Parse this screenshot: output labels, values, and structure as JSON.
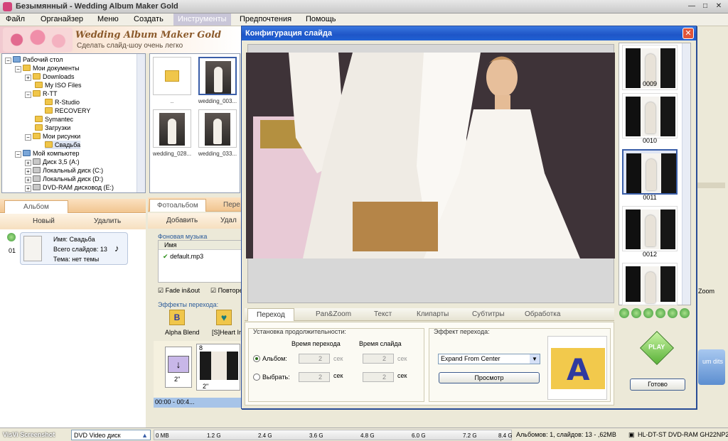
{
  "app": {
    "title": "Безымянный - Wedding Album Maker Gold"
  },
  "menu": [
    "Файл",
    "Органайзер",
    "Меню",
    "Создать",
    "Инструменты",
    "Предпочтения",
    "Помощь"
  ],
  "banner": {
    "title": "Wedding Album Maker Gold",
    "subtitle": "Сделать слайд-шоу очень легко"
  },
  "tree": [
    {
      "label": "Рабочий стол",
      "type": "pc"
    },
    {
      "label": "Мои документы",
      "type": "folder"
    },
    {
      "label": "Downloads",
      "type": "folder"
    },
    {
      "label": "My ISO Files",
      "type": "folder"
    },
    {
      "label": "R-TT",
      "type": "folder"
    },
    {
      "label": "R-Studio",
      "type": "folder"
    },
    {
      "label": "RECOVERY",
      "type": "folder"
    },
    {
      "label": "Symantec",
      "type": "folder"
    },
    {
      "label": "Загрузки",
      "type": "folder"
    },
    {
      "label": "Мои рисунки",
      "type": "folder"
    },
    {
      "label": "Свадьба",
      "type": "folder"
    },
    {
      "label": "Мой компьютер",
      "type": "pc"
    },
    {
      "label": "Диск 3,5 (A:)",
      "type": "drive"
    },
    {
      "label": "Локальный диск (C:)",
      "type": "drive"
    },
    {
      "label": "Локальный диск (D:)",
      "type": "drive"
    },
    {
      "label": "DVD-RAM дисковод (E:)",
      "type": "drive"
    }
  ],
  "thumbs": [
    "..",
    "wedding_003...",
    "wedding_028...",
    "wedding_033..."
  ],
  "album": {
    "tab": "Альбом",
    "new": "Новый",
    "delete": "Удалить",
    "index": "01",
    "name": "Имя: Свадьба",
    "slides": "Всего слайдов: 13",
    "theme": "Тема: нет темы"
  },
  "middle": {
    "tab1": "Фотоальбом",
    "tab2": "Пере",
    "add": "Добавить",
    "del": "Удал",
    "music_label": "Фоновая музыка",
    "col_name": "Имя",
    "track": "default.mp3",
    "fade": "Fade in&out",
    "repeat": "Повторе",
    "effects_label": "Эффекты перехода:",
    "eff1": "Alpha Blend",
    "eff2": "[S]Heart Iris",
    "tl_num1": "8",
    "tl_time": "00:00 - 00:4...",
    "dur1": "2\"",
    "dur2": "2\""
  },
  "dialog": {
    "title": "Конфигурация слайда",
    "close": "✕",
    "tabs": [
      "Переход",
      "Pan&Zoom",
      "Текст",
      "Клипарты",
      "Субтитры",
      "Обработка"
    ],
    "duration_group": "Установка продолжительности:",
    "trans_time": "Время перехода",
    "slide_time": "Время слайда",
    "album_radio": "Альбом:",
    "select_radio": "Выбрать:",
    "val": "2",
    "unit": "сек",
    "effect_group": "Эффект перехода:",
    "effect_value": "Expand From Center",
    "preview_btn": "Просмотр",
    "preview_letter": "A",
    "done_btn": "Готово",
    "play": "PLAY",
    "filmstrip": [
      "0009",
      "0010",
      "0011",
      "0012"
    ]
  },
  "rightpane": {
    "zoom": "Zoom",
    "credits": "um dits"
  },
  "status": {
    "source": "VisVi Screenshot",
    "disc": "DVD Video диск",
    "ticks": [
      "0 MB",
      "1.2 G",
      "2.4 G",
      "3.6 G",
      "4.8 G",
      "6.0 G",
      "7.2 G",
      "8.4 G"
    ],
    "info": "Альбомов: 1, слайдов: 13 - ,62MB",
    "drive": "HL-DT-ST DVD-RAM GH22NP20"
  }
}
